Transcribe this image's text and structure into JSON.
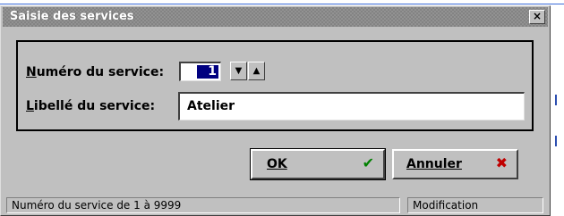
{
  "window": {
    "title": "Saisie des services",
    "close_symbol": "×"
  },
  "form": {
    "numero_label_accel": "N",
    "numero_label_rest": "uméro du service:",
    "numero_value": "1",
    "spin_down_symbol": "▼",
    "spin_up_symbol": "▲",
    "libelle_label_accel": "L",
    "libelle_label_rest": "ibellé du service:",
    "libelle_value": "Atelier"
  },
  "buttons": {
    "ok_label": "OK",
    "ok_icon": "check-icon",
    "cancel_label": "Annuler",
    "cancel_icon": "cross-icon"
  },
  "statusbar": {
    "hint": "Numéro du service de 1 à 9999",
    "mode": "Modification"
  },
  "colors": {
    "face": "#c0c0c0",
    "selection": "#000080",
    "ok_check": "#008000",
    "cancel_cross": "#c00000"
  }
}
